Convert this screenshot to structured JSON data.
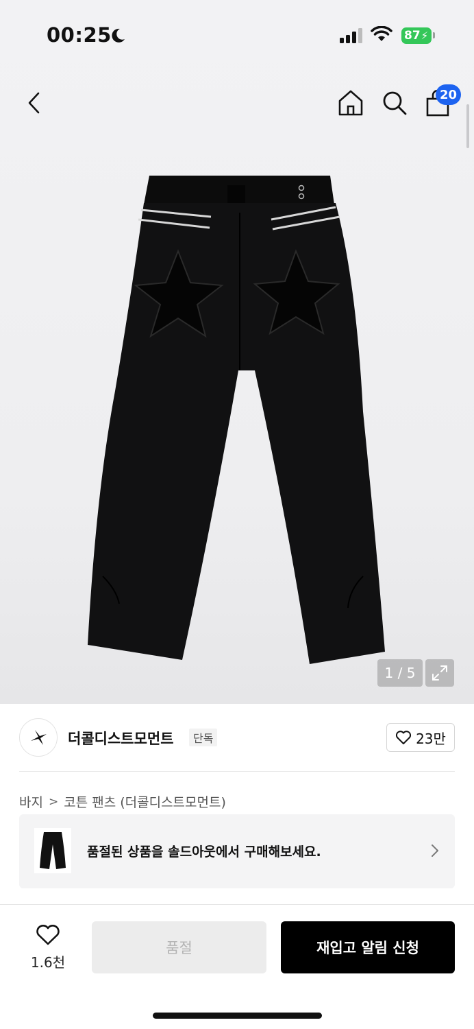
{
  "status_bar": {
    "time": "00:25",
    "battery": "87"
  },
  "header": {
    "cart_count": "20"
  },
  "gallery": {
    "counter": "1 / 5"
  },
  "brand": {
    "name": "더콜디스트모먼트",
    "exclusive_tag": "단독",
    "likes": "23만"
  },
  "breadcrumb": {
    "category": "바지",
    "separator": ">",
    "product": "코튼 팬츠 (더콜디스트모먼트)"
  },
  "soldout_banner": {
    "message": "품절된 상품을 솔드아웃에서 구매해보세요."
  },
  "action_bar": {
    "wish_count": "1.6천",
    "soldout_label": "품절",
    "restock_label": "재입고 알림 신청"
  },
  "icons": [
    "back-icon",
    "home-icon",
    "search-icon",
    "cart-icon",
    "expand-icon",
    "heart-icon",
    "chevron-right-icon",
    "brand-logo-icon",
    "moon-icon",
    "signal-icon",
    "wifi-icon"
  ],
  "colors": {
    "badge_blue": "#1d63f0",
    "battery_green": "#34c759",
    "primary_black": "#000000",
    "disabled_gray": "#ececec"
  }
}
